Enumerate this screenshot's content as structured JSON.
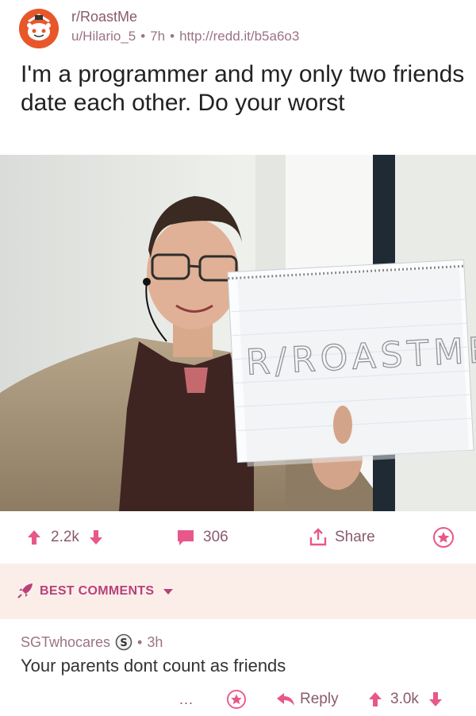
{
  "post": {
    "subreddit": "r/RoastMe",
    "author": "u/Hilario_5",
    "age": "7h",
    "link": "http://redd.it/b5a6o3",
    "title": "I'm a programmer and my only two friends date each other. Do your worst",
    "photo_sign_text": "R/ROASTME"
  },
  "actions": {
    "score": "2.2k",
    "comments": "306",
    "share_label": "Share"
  },
  "section": {
    "best_comments_label": "BEST COMMENTS"
  },
  "comment": {
    "author": "SGTwhocares",
    "age": "3h",
    "body": "Your parents dont count as friends",
    "more": "...",
    "reply_label": "Reply",
    "score": "3.0k"
  },
  "colors": {
    "upvote": "#e8578a",
    "accent": "#b7417a",
    "muted": "#9a7386",
    "best_bg": "#fbeee9",
    "snoo_bg": "#e8572a"
  }
}
